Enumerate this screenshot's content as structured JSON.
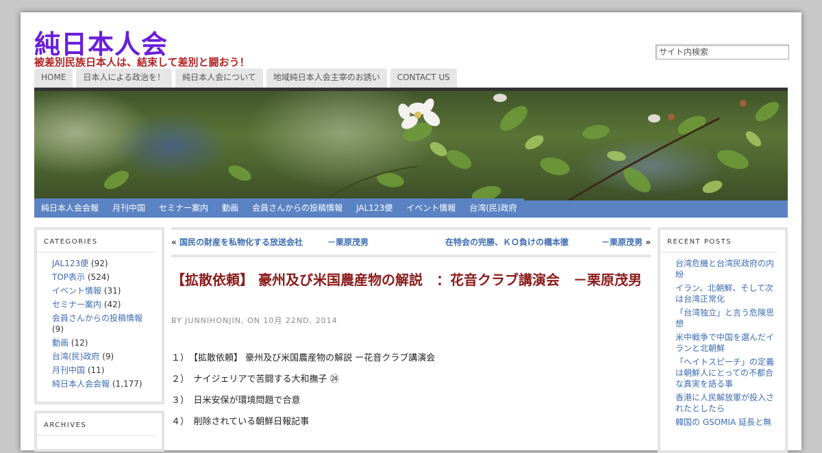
{
  "site": {
    "title": "純日本人会",
    "tagline": "被差別民族日本人は、結束して差別と闘おう！"
  },
  "search": {
    "placeholder": "サイト内検索"
  },
  "top_nav": [
    "HOME",
    "日本人による政治を！",
    "純日本人会について",
    "地域純日本人会主宰のお誘い",
    "CONTACT US"
  ],
  "secondary_nav": [
    "純日本人会会報",
    "月刊中国",
    "セミナー案内",
    "動画",
    "会員さんからの投稿情報",
    "JAL123便",
    "イベント情報",
    "台湾(民)政府"
  ],
  "categories": {
    "title": "CATEGORIES",
    "items": [
      {
        "label": "JAL123便",
        "count": "(92)"
      },
      {
        "label": "TOP表示",
        "count": "(524)"
      },
      {
        "label": "イベント情報",
        "count": "(31)"
      },
      {
        "label": "セミナー案内",
        "count": "(42)"
      },
      {
        "label": "会員さんからの投稿情報",
        "count": "(9)"
      },
      {
        "label": "動画",
        "count": "(12)"
      },
      {
        "label": "台湾(民)政府",
        "count": "(9)"
      },
      {
        "label": "月刊中国",
        "count": "(11)"
      },
      {
        "label": "純日本人会会報",
        "count": "(1,177)"
      }
    ]
  },
  "archives": {
    "title": "ARCHIVES"
  },
  "post_nav": {
    "prev_arrow": "«",
    "prev_label": "国民の財産を私物化する放送会社　　　－栗原茂男",
    "next_label": "在特会の完勝、ＫＯ負けの橋本徹　　　　－栗原茂男",
    "next_arrow": "»"
  },
  "post": {
    "title": "【拡散依頼】 豪州及び米国農産物の解説　：花音クラブ講演会　－栗原茂男",
    "meta": "BY JUNNIHONJIN, ON 10月 22ND, 2014",
    "lines": [
      "１）　【拡散依頼】 豪州及び米国農産物の解説 ー花音クラブ講演会",
      "２）　ナイジェリアで苦闘する大和撫子 ㉔",
      "３）　日米安保が環境問題で合意",
      "４）　削除されている朝鮮日報記事"
    ]
  },
  "recent_posts": {
    "title": "RECENT POSTS",
    "items": [
      "台湾危機と台湾民政府の内紛",
      "イラン、北朝鮮、そして次は台湾正常化",
      "「台湾独立」と言う危険思想",
      "米中戦争で中国を選んだイランと北朝鮮",
      "「ヘイトスピーチ」の定義は朝鮮人にとっての不都合な真実を語る事",
      "香港に人民解放軍が投入されたとしたら",
      "韓国の GSOMIA 延長と無"
    ]
  },
  "colors": {
    "title": "#6a1ed8",
    "tagline": "#b22222",
    "nav_bar": "#5b83c3",
    "link": "#3d6bb3",
    "post_title": "#8b1a1a"
  }
}
